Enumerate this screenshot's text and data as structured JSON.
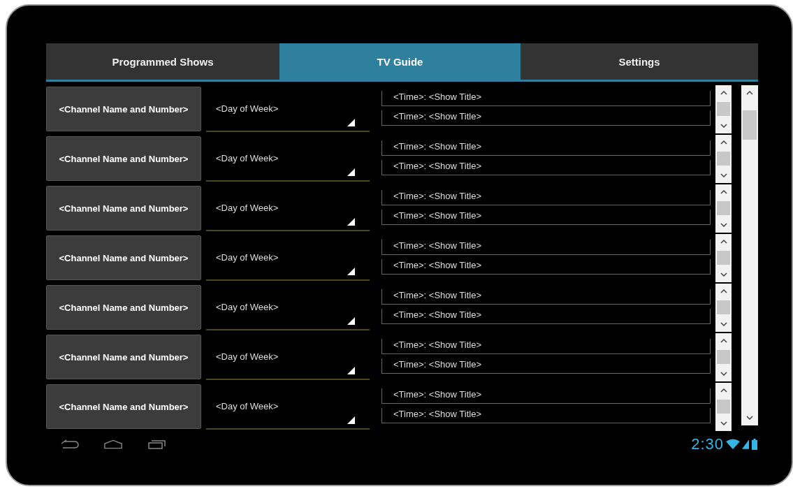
{
  "tabs": [
    {
      "label": "Programmed Shows",
      "selected": false
    },
    {
      "label": "TV Guide",
      "selected": true
    },
    {
      "label": "Settings",
      "selected": false
    }
  ],
  "rows": [
    {
      "channel": "<Channel Name and Number>",
      "day": "<Day of Week>",
      "shows": [
        "<Time>: <Show Title>",
        "<Time>: <Show Title>"
      ]
    },
    {
      "channel": "<Channel Name and Number>",
      "day": "<Day of Week>",
      "shows": [
        "<Time>: <Show Title>",
        "<Time>: <Show Title>"
      ]
    },
    {
      "channel": "<Channel Name and Number>",
      "day": "<Day of Week>",
      "shows": [
        "<Time>: <Show Title>",
        "<Time>: <Show Title>"
      ]
    },
    {
      "channel": "<Channel Name and Number>",
      "day": "<Day of Week>",
      "shows": [
        "<Time>: <Show Title>",
        "<Time>: <Show Title>"
      ]
    },
    {
      "channel": "<Channel Name and Number>",
      "day": "<Day of Week>",
      "shows": [
        "<Time>: <Show Title>",
        "<Time>: <Show Title>"
      ]
    },
    {
      "channel": "<Channel Name and Number>",
      "day": "<Day of Week>",
      "shows": [
        "<Time>: <Show Title>",
        "<Time>: <Show Title>"
      ]
    },
    {
      "channel": "<Channel Name and Number>",
      "day": "<Day of Week>",
      "shows": [
        "<Time>: <Show Title>",
        "<Time>: <Show Title>"
      ]
    }
  ],
  "status_bar": {
    "time": "2:30"
  }
}
